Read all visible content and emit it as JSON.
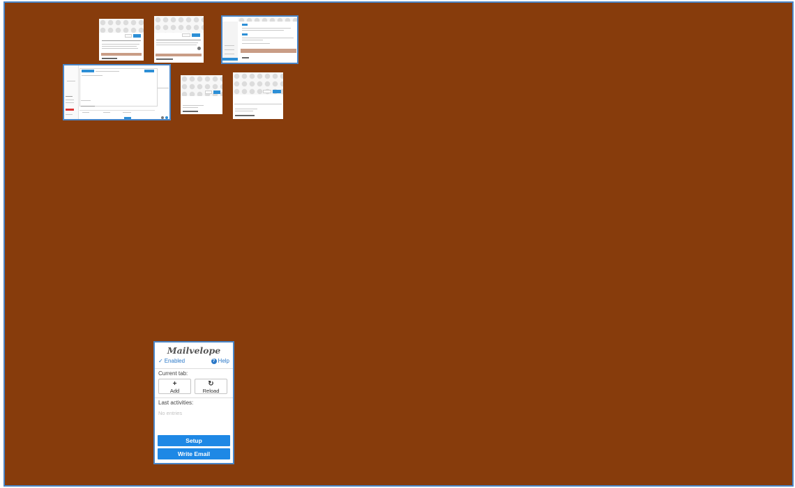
{
  "popup": {
    "logo": "Mailvelope",
    "enabled_label": "Enabled",
    "help_label": "Help",
    "current_tab_label": "Current tab:",
    "add_label": "Add",
    "reload_label": "Reload",
    "last_activities_label": "Last activities:",
    "no_entries": "No entries",
    "setup_label": "Setup",
    "write_email_label": "Write Email"
  },
  "colors": {
    "desktop": "#873c0c",
    "accent": "#1e88e5",
    "window_border": "#4a86c8"
  },
  "icons": {
    "enabled": "check-circle-icon",
    "help": "question-circle-icon",
    "add": "plus-icon",
    "reload": "refresh-icon"
  }
}
